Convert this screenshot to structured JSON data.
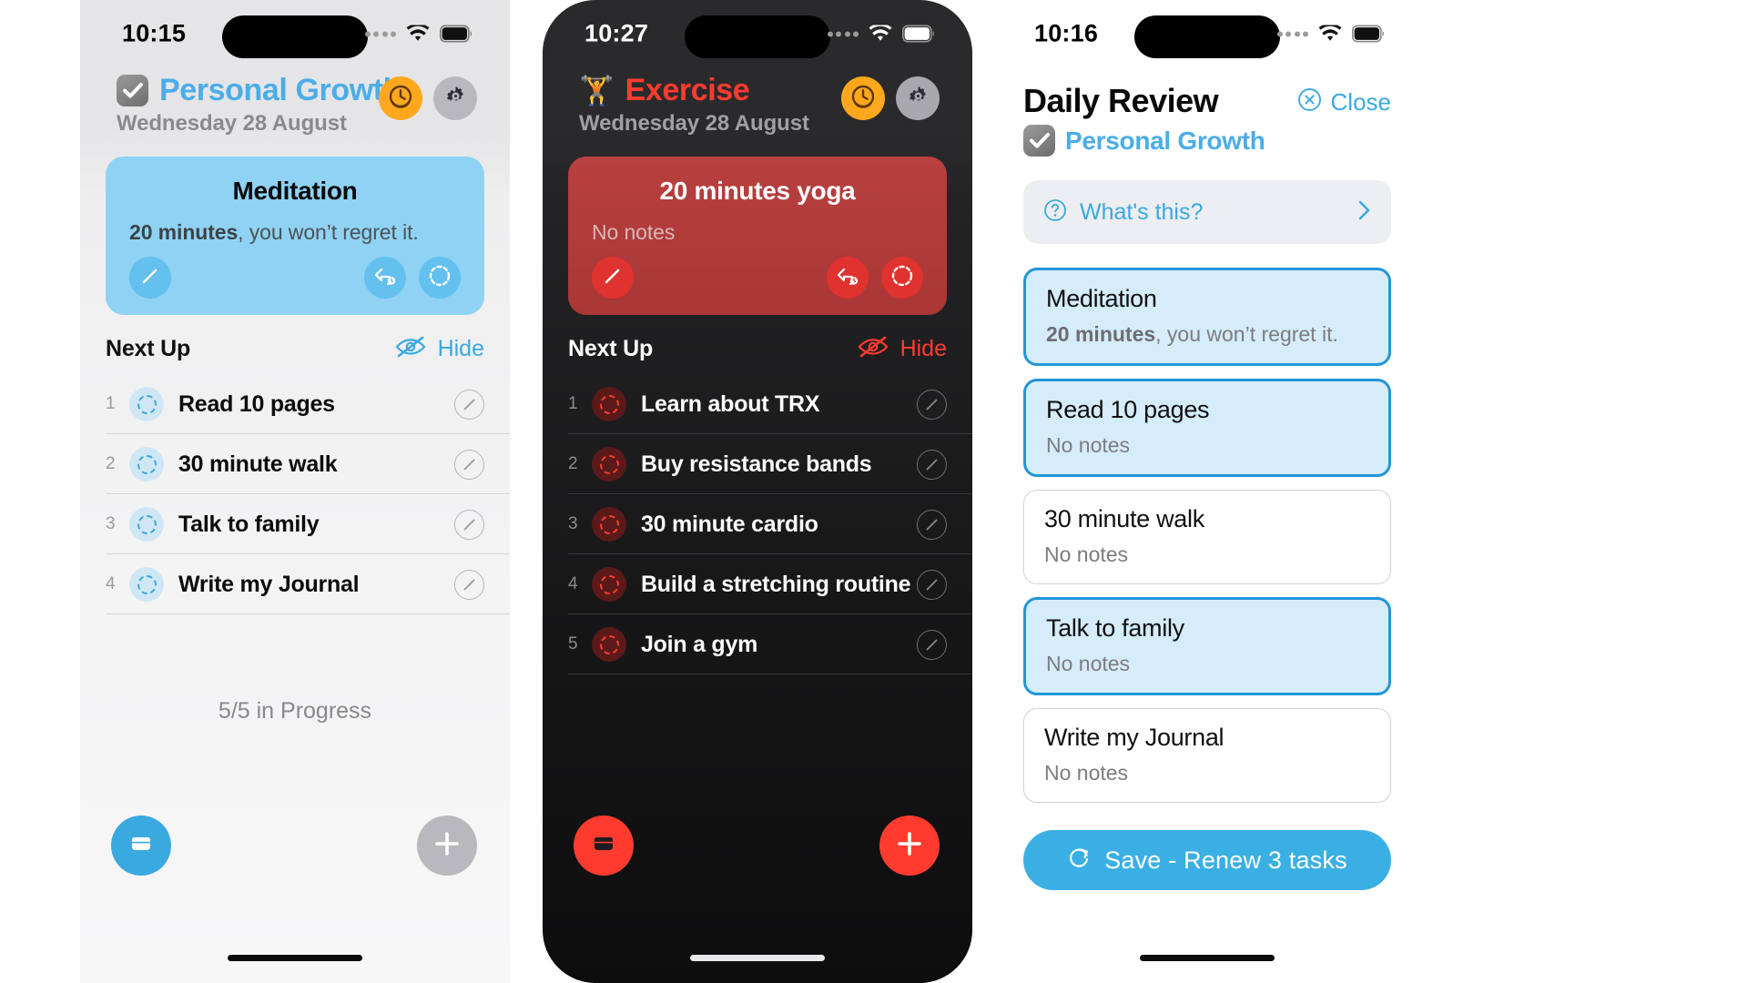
{
  "phones": {
    "personal": {
      "status": {
        "time": "10:15"
      },
      "header": {
        "title": "Personal Growth",
        "date": "Wednesday 28 August",
        "checkbox_icon": "checkbox-checked-icon",
        "clock_button_icon": "timer-icon",
        "gear_button_icon": "gear-icon"
      },
      "hero": {
        "title": "Meditation",
        "note_bold": "20 minutes",
        "note_rest": ", you won’t regret it.",
        "edit_icon": "pencil-icon",
        "snooze_icon": "snooze-arrow-icon",
        "progress_icon": "dashed-circle-icon"
      },
      "nextup": {
        "label": "Next Up",
        "hide_label": "Hide",
        "hide_icon": "eye-slash-icon"
      },
      "tasks": [
        {
          "index": "1",
          "name": "Read 10 pages"
        },
        {
          "index": "2",
          "name": "30 minute walk"
        },
        {
          "index": "3",
          "name": "Talk to family"
        },
        {
          "index": "4",
          "name": "Write my Journal"
        }
      ],
      "progress_text": "5/5 in Progress",
      "fab_archive_icon": "archive-box-icon",
      "fab_add_icon": "plus-icon"
    },
    "exercise": {
      "status": {
        "time": "10:27"
      },
      "header": {
        "title": "Exercise",
        "date": "Wednesday 28 August",
        "emoji": "🏋️",
        "clock_button_icon": "timer-icon",
        "gear_button_icon": "gear-icon"
      },
      "hero": {
        "title": "20 minutes yoga",
        "note_bold": "",
        "note_rest": "No notes",
        "edit_icon": "pencil-icon",
        "snooze_icon": "snooze-arrow-icon",
        "progress_icon": "dashed-circle-icon"
      },
      "nextup": {
        "label": "Next Up",
        "hide_label": "Hide",
        "hide_icon": "eye-slash-icon"
      },
      "tasks": [
        {
          "index": "1",
          "name": "Learn about TRX"
        },
        {
          "index": "2",
          "name": "Buy resistance bands"
        },
        {
          "index": "3",
          "name": "30 minute cardio"
        },
        {
          "index": "4",
          "name": "Build a stretching routine"
        },
        {
          "index": "5",
          "name": "Join a gym"
        }
      ],
      "fab_archive_icon": "archive-box-icon",
      "fab_add_icon": "plus-icon"
    },
    "review": {
      "status": {
        "time": "10:16"
      },
      "title": "Daily Review",
      "subtitle": "Personal Growth",
      "checkbox_icon": "checkbox-checked-icon",
      "close_label": "Close",
      "close_icon": "close-circle-icon",
      "whats_this": {
        "label": "What's this?",
        "help_icon": "question-circle-icon",
        "chevron_icon": "chevron-right-icon"
      },
      "cards": [
        {
          "title": "Meditation",
          "note_bold": "20 minutes",
          "note_rest": ", you won’t regret it.",
          "selected": true
        },
        {
          "title": "Read 10 pages",
          "note_bold": "",
          "note_rest": "No notes",
          "selected": true
        },
        {
          "title": "30 minute walk",
          "note_bold": "",
          "note_rest": "No notes",
          "selected": false
        },
        {
          "title": "Talk to family",
          "note_bold": "",
          "note_rest": "No notes",
          "selected": true
        },
        {
          "title": "Write my Journal",
          "note_bold": "",
          "note_rest": "No notes",
          "selected": false
        }
      ],
      "save_label": "Save  -  Renew 3 tasks",
      "save_icon": "refresh-icon"
    }
  },
  "colors": {
    "accent_blue": "#3aa9e0",
    "accent_red": "#ff3b30",
    "hero_blue": "#8fd2f4",
    "hero_red": "#b8403f",
    "orange": "#ffa81e"
  }
}
